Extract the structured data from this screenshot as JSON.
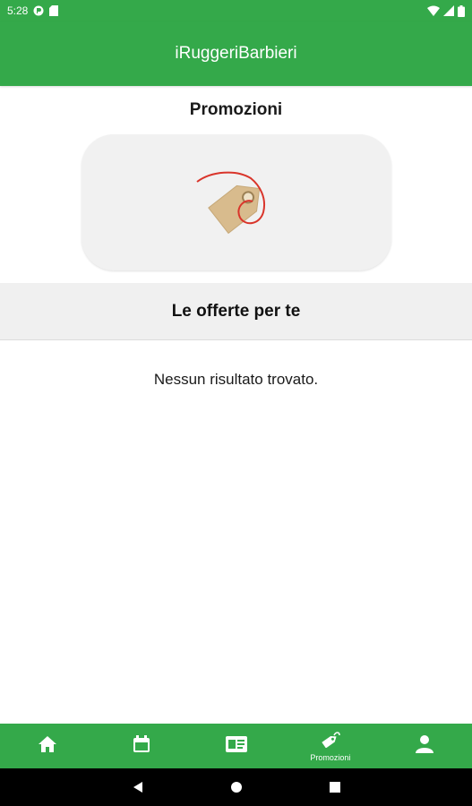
{
  "status_bar": {
    "time": "5:28",
    "icons": [
      "app-notification-icon",
      "sd-card-icon",
      "wifi-icon",
      "signal-icon",
      "battery-icon"
    ]
  },
  "app_bar": {
    "title": "iRuggeriBarbieri",
    "color": "#34a94a"
  },
  "promo": {
    "title": "Promozioni",
    "card_icon": "price-tag-icon"
  },
  "offers": {
    "title": "Le offerte per te",
    "empty_message": "Nessun risultato trovato."
  },
  "bottom_nav": {
    "items": [
      {
        "icon": "home-icon",
        "label": ""
      },
      {
        "icon": "calendar-icon",
        "label": ""
      },
      {
        "icon": "id-card-icon",
        "label": ""
      },
      {
        "icon": "tag-icon",
        "label": "Promozioni",
        "active": true
      },
      {
        "icon": "profile-icon",
        "label": ""
      }
    ]
  },
  "system_nav": {
    "buttons": [
      "back-icon",
      "home-circle-icon",
      "recents-icon"
    ]
  }
}
